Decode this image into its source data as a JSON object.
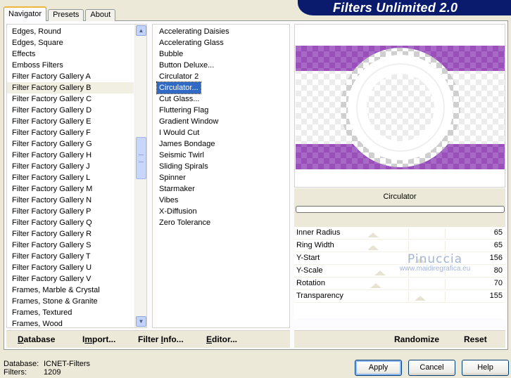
{
  "window": {
    "title": "Filters Unlimited 2.0"
  },
  "tabs": [
    {
      "label": "Navigator",
      "active": true
    },
    {
      "label": "Presets",
      "active": false
    },
    {
      "label": "About",
      "active": false
    }
  ],
  "categories": {
    "selected": "Filter Factory Gallery B",
    "items": [
      "Edges, Round",
      "Edges, Square",
      "Effects",
      "Emboss Filters",
      "Filter Factory Gallery A",
      "Filter Factory Gallery B",
      "Filter Factory Gallery C",
      "Filter Factory Gallery D",
      "Filter Factory Gallery E",
      "Filter Factory Gallery F",
      "Filter Factory Gallery G",
      "Filter Factory Gallery H",
      "Filter Factory Gallery J",
      "Filter Factory Gallery L",
      "Filter Factory Gallery M",
      "Filter Factory Gallery N",
      "Filter Factory Gallery P",
      "Filter Factory Gallery Q",
      "Filter Factory Gallery R",
      "Filter Factory Gallery S",
      "Filter Factory Gallery T",
      "Filter Factory Gallery U",
      "Filter Factory Gallery V",
      "Frames, Marble & Crystal",
      "Frames, Stone & Granite",
      "Frames, Textured",
      "Frames, Wood"
    ]
  },
  "filters": {
    "selected": "Circulator...",
    "items": [
      "Accelerating Daisies",
      "Accelerating Glass",
      "Bubble",
      "Button Deluxe...",
      "Circulator 2",
      "Circulator...",
      "Cut Glass...",
      "Fluttering Flag",
      "Gradient Window",
      "I Would Cut",
      "James Bondage",
      "Seismic Twirl",
      "Sliding Spirals",
      "Spinner",
      "Starmaker",
      "Vibes",
      "X-Diffusion",
      "Zero Tolerance"
    ]
  },
  "preview": {
    "filter_name": "Circulator",
    "band_color": "#9a4fba"
  },
  "params": [
    {
      "label": "Inner Radius",
      "value": "65",
      "fraction": 0.255
    },
    {
      "label": "Ring Width",
      "value": "65",
      "fraction": 0.255
    },
    {
      "label": "Y-Start",
      "value": "156",
      "fraction": 0.61
    },
    {
      "label": "Y-Scale",
      "value": "80",
      "fraction": 0.31
    },
    {
      "label": "Rotation",
      "value": "70",
      "fraction": 0.275
    },
    {
      "label": "Transparency",
      "value": "155",
      "fraction": 0.61
    }
  ],
  "watermark": {
    "line1": "Pinuccia",
    "line2": "www.maidiregrafica.eu"
  },
  "bottom_left": {
    "database_pre": "D",
    "database_post": "atabase",
    "import_pre": "I",
    "import_mid": "m",
    "import_post": "port...",
    "filterinfo_pre": "Filter ",
    "filterinfo_u": "I",
    "filterinfo_post": "nfo...",
    "editor_pre": "E",
    "editor_post": "ditor..."
  },
  "bottom_right": {
    "randomize": "Randomize",
    "reset": "Reset"
  },
  "status": {
    "database_label": "Database:",
    "database_value": "ICNET-Filters",
    "filters_label": "Filters:",
    "filters_value": "1209"
  },
  "buttons": {
    "apply": "Apply",
    "cancel": "Cancel",
    "help": "Help"
  }
}
